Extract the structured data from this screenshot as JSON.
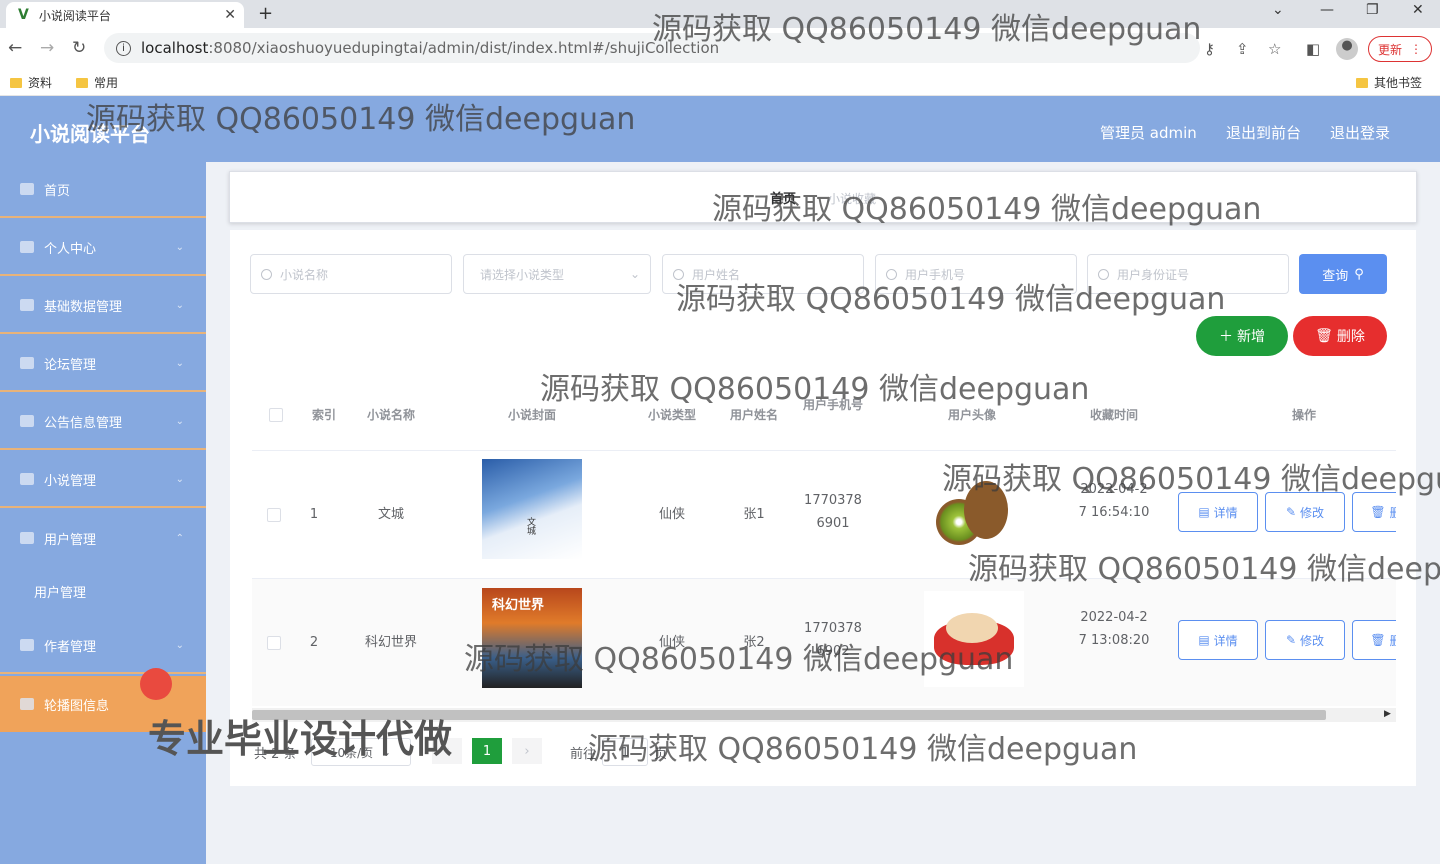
{
  "browser": {
    "tab_title": "小说阅读平台",
    "url_host": "localhost",
    "url_path": ":8080/xiaoshuoyuedupingtai/admin/dist/index.html#/shujiCollection",
    "update_label": "更新",
    "bookmarks": [
      "资料",
      "常用"
    ],
    "other_bookmarks": "其他书签"
  },
  "header": {
    "title": "小说阅读平台",
    "admin_label": "管理员 admin",
    "to_front_label": "退出到前台",
    "logout_label": "退出登录"
  },
  "sidebar": {
    "items": [
      {
        "label": "首页"
      },
      {
        "label": "个人中心"
      },
      {
        "label": "基础数据管理"
      },
      {
        "label": "论坛管理"
      },
      {
        "label": "公告信息管理"
      },
      {
        "label": "小说管理"
      },
      {
        "label": "用户管理"
      },
      {
        "label": "作者管理"
      },
      {
        "label": "轮播图信息"
      }
    ],
    "submenu_label": "用户管理"
  },
  "breadcrumb": {
    "home": "首页",
    "current": "小说收藏"
  },
  "search": {
    "name_placeholder": "小说名称",
    "type_placeholder": "请选择小说类型",
    "user_name_placeholder": "用户姓名",
    "user_phone_placeholder": "用户手机号",
    "user_id_placeholder": "用户身份证号",
    "query_label": "查询"
  },
  "actions": {
    "add_label": "新增",
    "delete_label": "删除"
  },
  "table": {
    "headers": [
      "索引",
      "小说名称",
      "小说封面",
      "小说类型",
      "用户姓名",
      "用户手机号",
      "用户头像",
      "收藏时间",
      "操作"
    ],
    "rows": [
      {
        "index": "1",
        "name": "文城",
        "cover_text": "文城",
        "type": "仙侠",
        "user": "张1",
        "phone": "1770378 6901",
        "time": "2022-04-27 16:54:10"
      },
      {
        "index": "2",
        "name": "科幻世界",
        "cover_text": "科幻世界",
        "type": "仙侠",
        "user": "张2",
        "phone": "1770378 6902",
        "time": "2022-04-27 13:08:20"
      }
    ],
    "detail_label": "详情",
    "edit_label": "修改",
    "delete_label": "删除"
  },
  "pagination": {
    "total_label": "共 2 条",
    "page_size_label": "10条/页",
    "current_page": "1",
    "goto_label": "前往",
    "goto_value": "1",
    "page_suffix": "页"
  },
  "watermark": {
    "text": "源码获取 QQ86050149 微信deepguan",
    "big_text": "专业毕业设计代做"
  }
}
